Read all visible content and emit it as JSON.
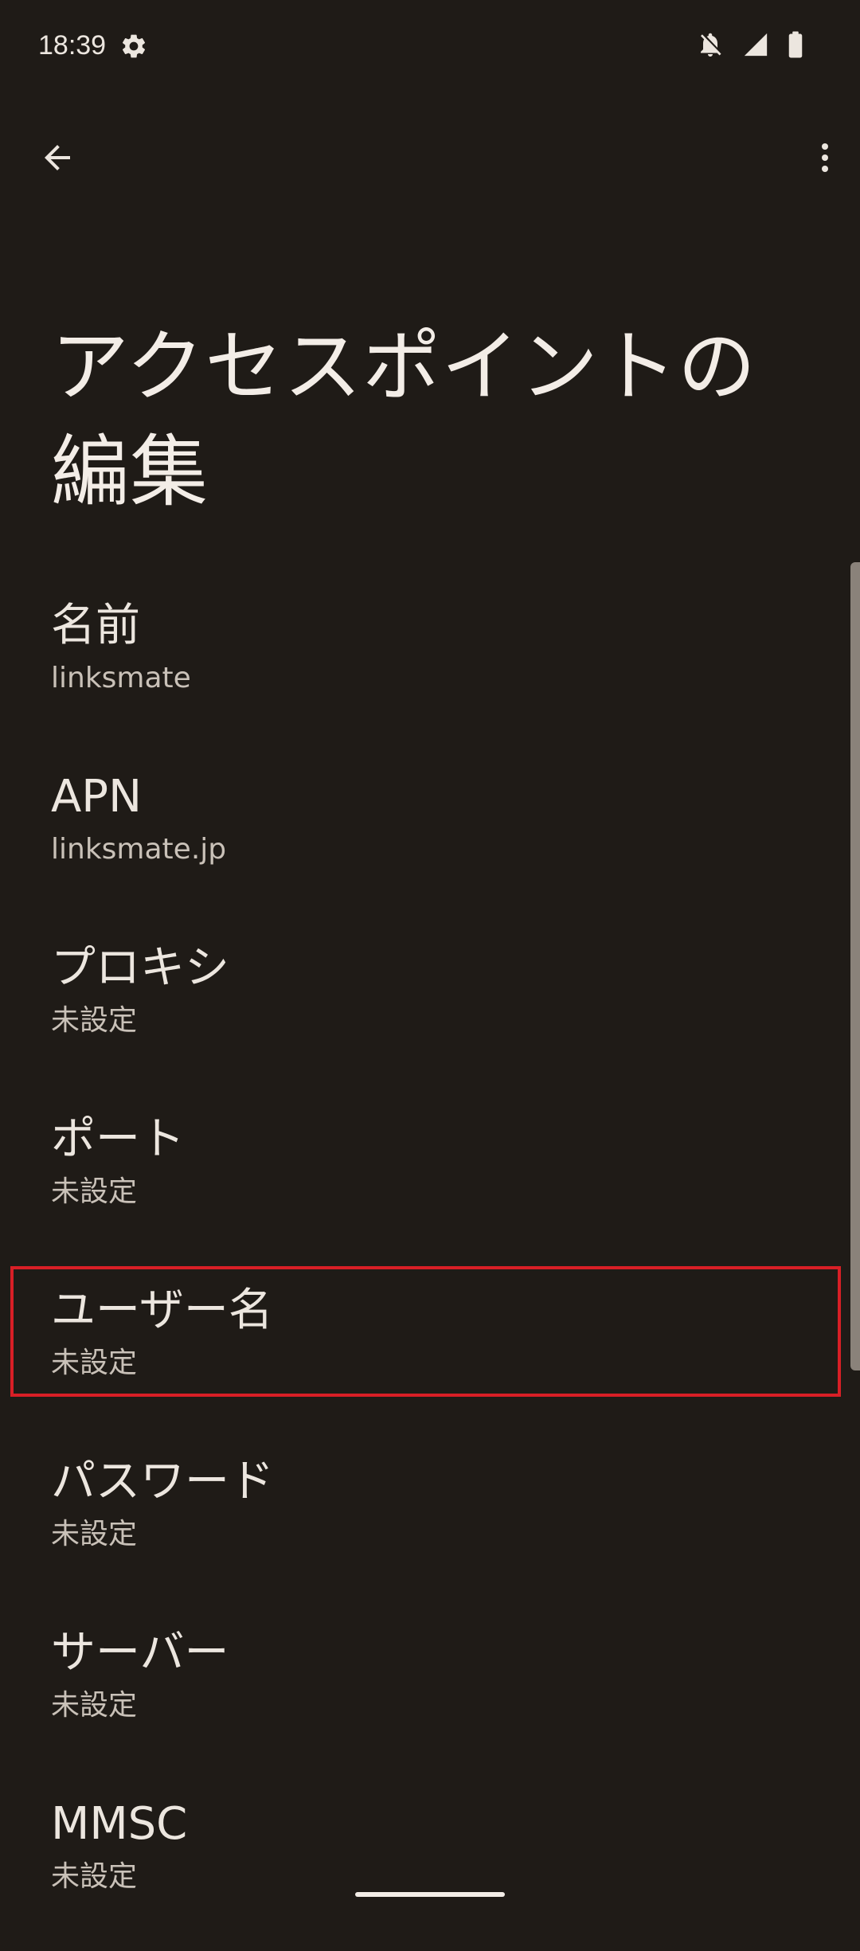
{
  "status_bar": {
    "time": "18:39",
    "icons": [
      "gear-icon",
      "notifications-off-icon",
      "cell-signal-icon",
      "battery-icon"
    ]
  },
  "toolbar": {
    "back_icon": "arrow-back-icon",
    "more_icon": "more-vert-icon"
  },
  "page": {
    "title": "アクセスポイントの編集"
  },
  "preferences": [
    {
      "title": "名前",
      "summary": "linksmate"
    },
    {
      "title": "APN",
      "summary": "linksmate.jp"
    },
    {
      "title": "プロキシ",
      "summary": "未設定"
    },
    {
      "title": "ポート",
      "summary": "未設定"
    },
    {
      "title": "ユーザー名",
      "summary": "未設定"
    },
    {
      "title": "パスワード",
      "summary": "未設定"
    },
    {
      "title": "サーバー",
      "summary": "未設定"
    },
    {
      "title": "MMSC",
      "summary": "未設定"
    }
  ],
  "colors": {
    "background": "#1f1b17",
    "text": "#ece6df",
    "summary": "#c9c1b8",
    "highlight": "#d81f26"
  }
}
